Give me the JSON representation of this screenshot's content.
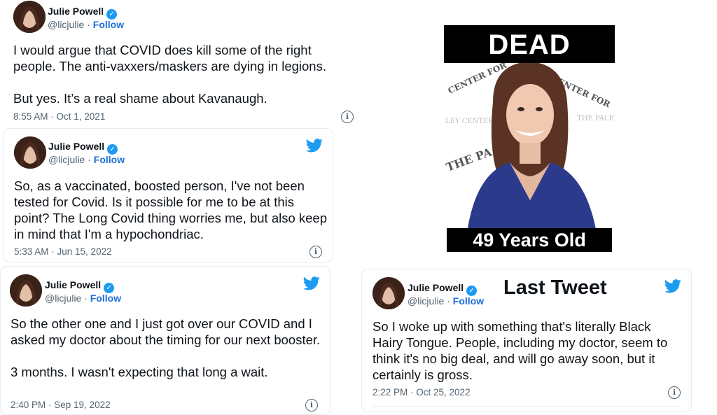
{
  "tweets": [
    {
      "name": "Julie Powell",
      "handle": "@licjulie",
      "follow": "Follow",
      "text": "I would argue that COVID does kill some of the right people. The anti-vaxxers/maskers are dying in legions.\n\nBut yes. It’s a real shame about Kavanaugh.",
      "time": "8:55 AM · Oct 1, 2021"
    },
    {
      "name": "Julie Powell",
      "handle": "@licjulie",
      "follow": "Follow",
      "text": "So, as a vaccinated, boosted person, I've not been tested for Covid. Is it possible for me to be at this point? The Long Covid thing worries me, but also keep in mind that I'm a hypochondriac.",
      "time": "5:33 AM · Jun 15, 2022"
    },
    {
      "name": "Julie Powell",
      "handle": "@licjulie",
      "follow": "Follow",
      "text": "So the other one and I just got over our COVID and I asked my doctor about the timing for our next booster.\n\n3 months. I wasn't expecting that long a wait.",
      "time": "2:40 PM · Sep 19, 2022"
    },
    {
      "name": "Julie Powell",
      "handle": "@licjulie",
      "follow": "Follow",
      "text": "So I woke up with something that's literally Black Hairy Tongue. People, including my doctor, seem to think it's no big deal, and will go away soon, but it certainly is gross.",
      "time": "2:22 PM · Oct 25, 2022"
    }
  ],
  "separator": " · ",
  "verified_icon": "verified-check-icon",
  "twitter_icon": "twitter-bird-icon",
  "info_icon": "info-circle-icon",
  "photo": {
    "top_banner": "DEAD",
    "bottom_banner": "49 Years Old",
    "backdrop_text_1": "THE PALEY CENTER FOR MEDIA",
    "backdrop_text_2": "THE PALEY CI",
    "backdrop_text_3": "LEY CENTER F"
  },
  "last_tweet_label": "Last Tweet",
  "colors": {
    "verified": "#1d9bf0",
    "link": "#1d6fd8",
    "muted": "#536471",
    "banner": "#000000"
  }
}
